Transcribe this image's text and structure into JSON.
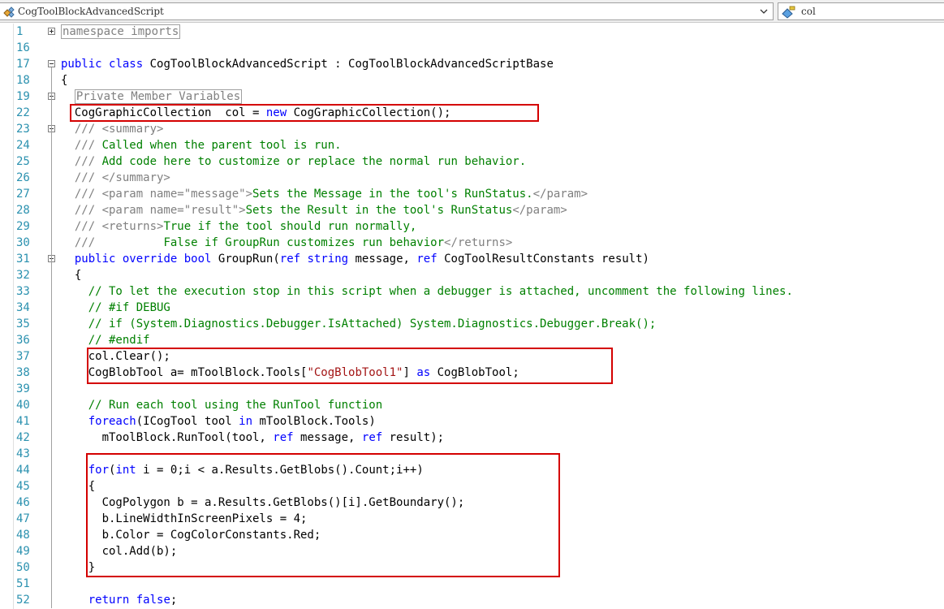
{
  "navbar": {
    "class_selector": "CogToolBlockAdvancedScript",
    "member_selector": "col"
  },
  "lines": [
    {
      "n": "1",
      "segs": [
        {
          "t": "collapsed",
          "v": "namespace imports"
        }
      ]
    },
    {
      "n": "16",
      "segs": []
    },
    {
      "n": "17",
      "segs": [
        {
          "t": "kw",
          "v": "public"
        },
        {
          "t": "ty",
          "v": " "
        },
        {
          "t": "kw",
          "v": "class"
        },
        {
          "t": "ty",
          "v": " CogToolBlockAdvancedScript : CogToolBlockAdvancedScriptBase"
        }
      ]
    },
    {
      "n": "18",
      "segs": [
        {
          "t": "ty",
          "v": "{"
        }
      ]
    },
    {
      "n": "19",
      "segs": [
        {
          "t": "ty",
          "v": "  "
        },
        {
          "t": "collapsed",
          "v": "Private Member Variables"
        }
      ]
    },
    {
      "n": "22",
      "segs": [
        {
          "t": "ty",
          "v": "  CogGraphicCollection  col = "
        },
        {
          "t": "kw",
          "v": "new"
        },
        {
          "t": "ty",
          "v": " CogGraphicCollection();"
        }
      ]
    },
    {
      "n": "23",
      "segs": [
        {
          "t": "dc",
          "v": "  /// <summary>"
        }
      ]
    },
    {
      "n": "24",
      "segs": [
        {
          "t": "dc",
          "v": "  /// "
        },
        {
          "t": "cm",
          "v": "Called when the parent tool is run."
        }
      ]
    },
    {
      "n": "25",
      "segs": [
        {
          "t": "dc",
          "v": "  /// "
        },
        {
          "t": "cm",
          "v": "Add code here to customize or replace the normal run behavior."
        }
      ]
    },
    {
      "n": "26",
      "segs": [
        {
          "t": "dc",
          "v": "  /// </summary>"
        }
      ]
    },
    {
      "n": "27",
      "segs": [
        {
          "t": "dc",
          "v": "  /// <param name=\"message\">"
        },
        {
          "t": "cm",
          "v": "Sets the Message in the tool's RunStatus."
        },
        {
          "t": "dc",
          "v": "</param>"
        }
      ]
    },
    {
      "n": "28",
      "segs": [
        {
          "t": "dc",
          "v": "  /// <param name=\"result\">"
        },
        {
          "t": "cm",
          "v": "Sets the Result in the tool's RunStatus"
        },
        {
          "t": "dc",
          "v": "</param>"
        }
      ]
    },
    {
      "n": "29",
      "segs": [
        {
          "t": "dc",
          "v": "  /// <returns>"
        },
        {
          "t": "cm",
          "v": "True if the tool should run normally,"
        }
      ]
    },
    {
      "n": "30",
      "segs": [
        {
          "t": "dc",
          "v": "  ///          "
        },
        {
          "t": "cm",
          "v": "False if GroupRun customizes run behavior"
        },
        {
          "t": "dc",
          "v": "</returns>"
        }
      ]
    },
    {
      "n": "31",
      "segs": [
        {
          "t": "ty",
          "v": "  "
        },
        {
          "t": "kw",
          "v": "public"
        },
        {
          "t": "ty",
          "v": " "
        },
        {
          "t": "kw",
          "v": "override"
        },
        {
          "t": "ty",
          "v": " "
        },
        {
          "t": "kw",
          "v": "bool"
        },
        {
          "t": "ty",
          "v": " GroupRun("
        },
        {
          "t": "kw",
          "v": "ref"
        },
        {
          "t": "ty",
          "v": " "
        },
        {
          "t": "kw",
          "v": "string"
        },
        {
          "t": "ty",
          "v": " message, "
        },
        {
          "t": "kw",
          "v": "ref"
        },
        {
          "t": "ty",
          "v": " CogToolResultConstants result)"
        }
      ]
    },
    {
      "n": "32",
      "segs": [
        {
          "t": "ty",
          "v": "  {"
        }
      ]
    },
    {
      "n": "33",
      "segs": [
        {
          "t": "cm",
          "v": "    // To let the execution stop in this script when a debugger is attached, uncomment the following lines."
        }
      ]
    },
    {
      "n": "34",
      "segs": [
        {
          "t": "cm",
          "v": "    // #if DEBUG"
        }
      ]
    },
    {
      "n": "35",
      "segs": [
        {
          "t": "cm",
          "v": "    // if (System.Diagnostics.Debugger.IsAttached) System.Diagnostics.Debugger.Break();"
        }
      ]
    },
    {
      "n": "36",
      "segs": [
        {
          "t": "cm",
          "v": "    // #endif"
        }
      ]
    },
    {
      "n": "37",
      "segs": [
        {
          "t": "ty",
          "v": "    col.Clear();"
        }
      ]
    },
    {
      "n": "38",
      "segs": [
        {
          "t": "ty",
          "v": "    CogBlobTool a= mToolBlock.Tools["
        },
        {
          "t": "st",
          "v": "\"CogBlobTool1\""
        },
        {
          "t": "ty",
          "v": "] "
        },
        {
          "t": "kw",
          "v": "as"
        },
        {
          "t": "ty",
          "v": " CogBlobTool;"
        }
      ]
    },
    {
      "n": "39",
      "segs": []
    },
    {
      "n": "40",
      "segs": [
        {
          "t": "cm",
          "v": "    // Run each tool using the RunTool function"
        }
      ]
    },
    {
      "n": "41",
      "segs": [
        {
          "t": "ty",
          "v": "    "
        },
        {
          "t": "kw",
          "v": "foreach"
        },
        {
          "t": "ty",
          "v": "(ICogTool tool "
        },
        {
          "t": "kw",
          "v": "in"
        },
        {
          "t": "ty",
          "v": " mToolBlock.Tools)"
        }
      ]
    },
    {
      "n": "42",
      "segs": [
        {
          "t": "ty",
          "v": "      mToolBlock.RunTool(tool, "
        },
        {
          "t": "kw",
          "v": "ref"
        },
        {
          "t": "ty",
          "v": " message, "
        },
        {
          "t": "kw",
          "v": "ref"
        },
        {
          "t": "ty",
          "v": " result);"
        }
      ]
    },
    {
      "n": "43",
      "segs": []
    },
    {
      "n": "44",
      "segs": [
        {
          "t": "ty",
          "v": "    "
        },
        {
          "t": "kw",
          "v": "for"
        },
        {
          "t": "ty",
          "v": "("
        },
        {
          "t": "kw",
          "v": "int"
        },
        {
          "t": "ty",
          "v": " i = 0;i < a.Results.GetBlobs().Count;i++)"
        }
      ]
    },
    {
      "n": "45",
      "segs": [
        {
          "t": "ty",
          "v": "    {"
        }
      ]
    },
    {
      "n": "46",
      "segs": [
        {
          "t": "ty",
          "v": "      CogPolygon b = a.Results.GetBlobs()[i].GetBoundary();"
        }
      ]
    },
    {
      "n": "47",
      "segs": [
        {
          "t": "ty",
          "v": "      b.LineWidthInScreenPixels = 4;"
        }
      ]
    },
    {
      "n": "48",
      "segs": [
        {
          "t": "ty",
          "v": "      b.Color = CogColorConstants.Red;"
        }
      ]
    },
    {
      "n": "49",
      "segs": [
        {
          "t": "ty",
          "v": "      col.Add(b);"
        }
      ]
    },
    {
      "n": "50",
      "segs": [
        {
          "t": "ty",
          "v": "    }"
        }
      ]
    },
    {
      "n": "51",
      "segs": []
    },
    {
      "n": "52",
      "segs": [
        {
          "t": "ty",
          "v": "    "
        },
        {
          "t": "kw",
          "v": "return"
        },
        {
          "t": "ty",
          "v": " "
        },
        {
          "t": "kw",
          "v": "false"
        },
        {
          "t": "ty",
          "v": ";"
        }
      ]
    }
  ],
  "outline_markers": [
    {
      "line_index": 0,
      "kind": "plus"
    },
    {
      "line_index": 2,
      "kind": "minus"
    },
    {
      "line_index": 4,
      "kind": "plus"
    },
    {
      "line_index": 6,
      "kind": "minus"
    },
    {
      "line_index": 14,
      "kind": "minus"
    }
  ],
  "highlight_boxes": [
    {
      "label": "col-declaration"
    },
    {
      "label": "blobtool-lookup"
    },
    {
      "label": "blob-loop"
    }
  ],
  "colors": {
    "keyword": "#0000ff",
    "comment": "#008000",
    "doc_tag": "#808080",
    "string": "#a31515",
    "line_number": "#2b91af",
    "highlight_box": "#d40000"
  }
}
